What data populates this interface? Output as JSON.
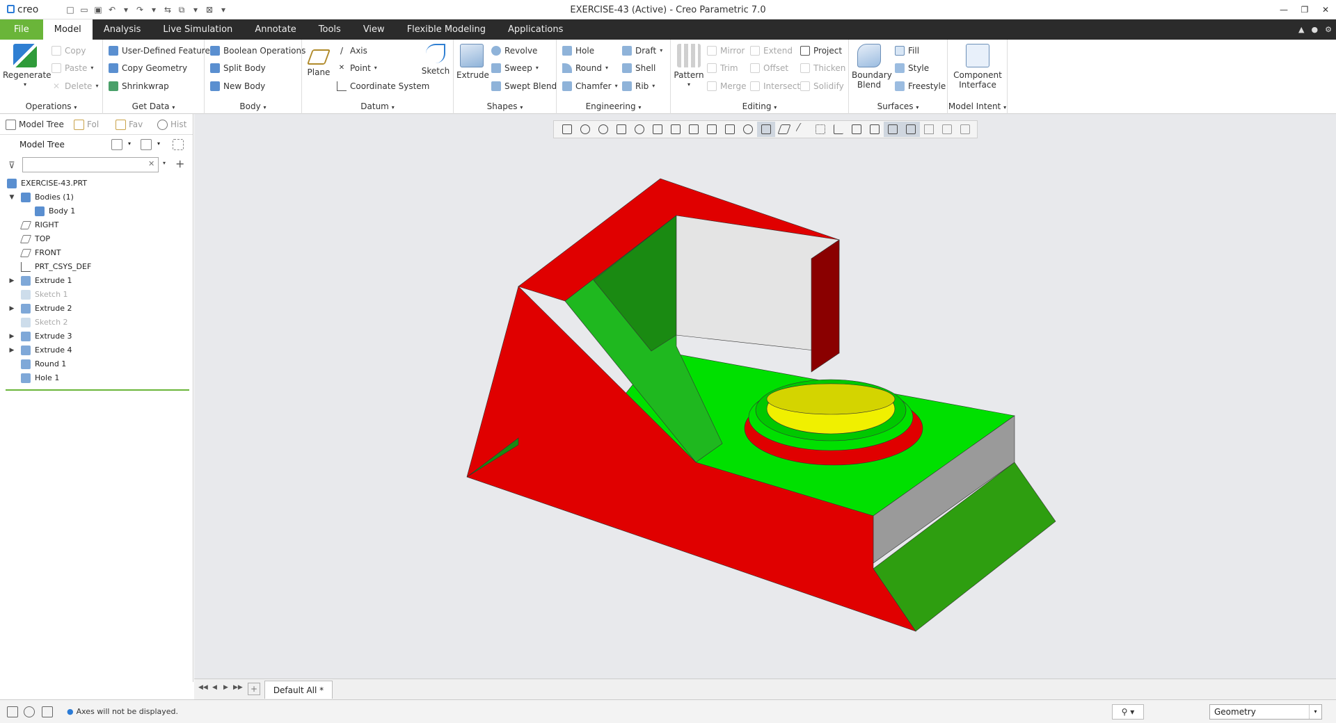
{
  "app": {
    "title": "EXERCISE-43 (Active) - Creo Parametric 7.0",
    "logo": "creo"
  },
  "menu": {
    "tabs": [
      "File",
      "Model",
      "Analysis",
      "Live Simulation",
      "Annotate",
      "Tools",
      "View",
      "Flexible Modeling",
      "Applications"
    ],
    "active": "Model"
  },
  "ribbon": {
    "operations": {
      "label": "Operations",
      "regenerate": "Regenerate",
      "copy": "Copy",
      "paste": "Paste",
      "delete": "Delete"
    },
    "getdata": {
      "label": "Get Data",
      "udf": "User-Defined Feature",
      "copy_geometry": "Copy Geometry",
      "shrinkwrap": "Shrinkwrap"
    },
    "body": {
      "label": "Body",
      "boolean": "Boolean Operations",
      "split": "Split Body",
      "new": "New Body"
    },
    "datum": {
      "label": "Datum",
      "plane": "Plane",
      "axis": "Axis",
      "point": "Point",
      "csys": "Coordinate System",
      "sketch": "Sketch"
    },
    "shapes": {
      "label": "Shapes",
      "extrude": "Extrude",
      "revolve": "Revolve",
      "sweep": "Sweep",
      "swept_blend": "Swept Blend"
    },
    "engineering": {
      "label": "Engineering",
      "hole": "Hole",
      "round": "Round",
      "chamfer": "Chamfer",
      "draft": "Draft",
      "shell": "Shell",
      "rib": "Rib"
    },
    "editing": {
      "label": "Editing",
      "pattern": "Pattern",
      "mirror": "Mirror",
      "trim": "Trim",
      "merge": "Merge",
      "extend": "Extend",
      "offset": "Offset",
      "intersect": "Intersect",
      "project": "Project",
      "thicken": "Thicken",
      "solidify": "Solidify"
    },
    "surfaces": {
      "label": "Surfaces",
      "boundary_blend_1": "Boundary",
      "boundary_blend_2": "Blend",
      "fill": "Fill",
      "style": "Style",
      "freestyle": "Freestyle"
    },
    "modelintent": {
      "label": "Model Intent",
      "component_1": "Component",
      "component_2": "Interface"
    }
  },
  "leftpanel": {
    "tabs": [
      "Model Tree",
      "Fol",
      "Fav",
      "Hist"
    ],
    "header": "Model Tree",
    "filter_placeholder": "",
    "tree": [
      {
        "label": "EXERCISE-43.PRT",
        "icon": "part-icon",
        "dim": false,
        "expander": ""
      },
      {
        "label": "Bodies (1)",
        "icon": "bodies-icon",
        "dim": false,
        "expander": "▼"
      },
      {
        "label": "Body 1",
        "icon": "body-icon",
        "dim": false,
        "expander": ""
      },
      {
        "label": "RIGHT",
        "icon": "datum-plane-icon",
        "dim": false,
        "expander": ""
      },
      {
        "label": "TOP",
        "icon": "datum-plane-icon",
        "dim": false,
        "expander": ""
      },
      {
        "label": "FRONT",
        "icon": "datum-plane-icon",
        "dim": false,
        "expander": ""
      },
      {
        "label": "PRT_CSYS_DEF",
        "icon": "csys-icon",
        "dim": false,
        "expander": ""
      },
      {
        "label": "Extrude 1",
        "icon": "extrude-icon",
        "dim": false,
        "expander": "▶"
      },
      {
        "label": "Sketch 1",
        "icon": "sketch-icon",
        "dim": true,
        "expander": ""
      },
      {
        "label": "Extrude 2",
        "icon": "extrude-icon",
        "dim": false,
        "expander": "▶"
      },
      {
        "label": "Sketch 2",
        "icon": "sketch-icon",
        "dim": true,
        "expander": ""
      },
      {
        "label": "Extrude 3",
        "icon": "extrude-icon",
        "dim": false,
        "expander": "▶"
      },
      {
        "label": "Extrude 4",
        "icon": "extrude-icon",
        "dim": false,
        "expander": "▶"
      },
      {
        "label": "Round 1",
        "icon": "round-icon",
        "dim": false,
        "expander": ""
      },
      {
        "label": "Hole 1",
        "icon": "hole-icon",
        "dim": false,
        "expander": ""
      }
    ]
  },
  "graphics": {
    "sheet_tab": "Default All *"
  },
  "status": {
    "message": "Axes will not be displayed.",
    "filter": "Geometry"
  },
  "colors": {
    "green": "#00e000",
    "red": "#e00000",
    "yellow": "#f0f000",
    "gray": "#9a9a9a",
    "background": "#e8e9ec",
    "accent": "#6ab539"
  }
}
